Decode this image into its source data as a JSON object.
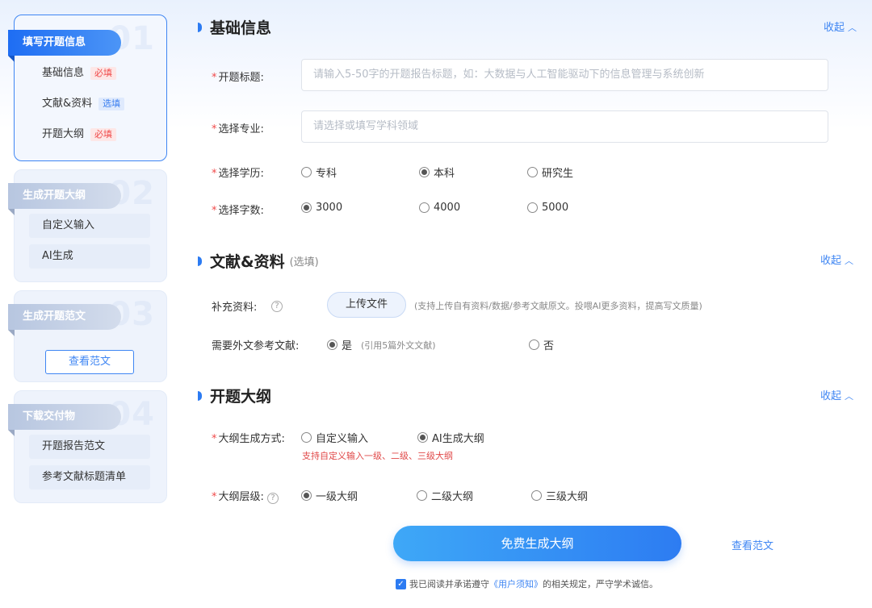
{
  "sidebar": {
    "steps": [
      {
        "num": "01",
        "title": "填写开题信息",
        "items": [
          {
            "label": "基础信息",
            "tag": "必填"
          },
          {
            "label": "文献&资料",
            "tag": "选填"
          },
          {
            "label": "开题大纲",
            "tag": "必填"
          }
        ]
      },
      {
        "num": "02",
        "title": "生成开题大纲",
        "items": [
          {
            "label": "自定义输入"
          },
          {
            "label": "AI生成"
          }
        ]
      },
      {
        "num": "03",
        "title": "生成开题范文",
        "button": "查看范文"
      },
      {
        "num": "04",
        "title": "下载交付物",
        "items": [
          {
            "label": "开题报告范文"
          },
          {
            "label": "参考文献标题清单"
          }
        ]
      }
    ]
  },
  "sections": {
    "basic": {
      "title": "基础信息",
      "collapse": "收起"
    },
    "literature": {
      "title": "文献&资料",
      "subtitle": "(选填)",
      "collapse": "收起"
    },
    "outline": {
      "title": "开题大纲",
      "collapse": "收起"
    }
  },
  "form": {
    "title": {
      "label": "开题标题:",
      "placeholder": "请输入5-50字的开题报告标题，如：大数据与人工智能驱动下的信息管理与系统创新"
    },
    "major": {
      "label": "选择专业:",
      "placeholder": "请选择或填写学科领域"
    },
    "degree": {
      "label": "选择学历:",
      "options": [
        "专科",
        "本科",
        "研究生"
      ],
      "selected": "本科"
    },
    "wordcount": {
      "label": "选择字数:",
      "options": [
        "3000",
        "4000",
        "5000"
      ],
      "selected": "3000"
    },
    "supplement": {
      "label": "补充资料:",
      "button": "上传文件",
      "hint": "(支持上传自有资料/数据/参考文献原文。投喂AI更多资料，提高写文质量)"
    },
    "foreign_refs": {
      "label": "需要外文参考文献:",
      "options": [
        "是",
        "否"
      ],
      "selected": "是",
      "hint": "(引用5篇外文文献)"
    },
    "outline_mode": {
      "label": "大纲生成方式:",
      "options": [
        "自定义输入",
        "AI生成大纲"
      ],
      "selected": "AI生成大纲",
      "hint": "支持自定义输入一级、二级、三级大纲"
    },
    "outline_level": {
      "label": "大纲层级:",
      "options": [
        "一级大纲",
        "二级大纲",
        "三级大纲"
      ],
      "selected": "一级大纲"
    }
  },
  "actions": {
    "generate": "免费生成大纲",
    "view_sample": "查看范文",
    "agree_prefix": "我已阅读并承诺遵守",
    "agree_link": "《用户须知》",
    "agree_suffix": "的相关规定，严守学术诚信。"
  },
  "colors": {
    "accent": "#2c7bf2",
    "required": "#f04a4a"
  },
  "icons": {
    "collapse": "chevron-up-icon",
    "help": "question-circle-icon",
    "section": "section-bar-icon"
  }
}
